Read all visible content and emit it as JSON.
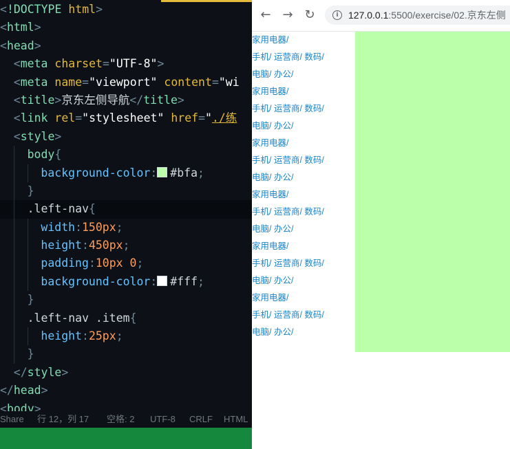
{
  "editor": {
    "lines": [
      {
        "indent": 0,
        "tokens": [
          [
            "punct",
            "<"
          ],
          [
            "tag",
            "!DOCTYPE"
          ],
          [
            "plain",
            " "
          ],
          [
            "attr",
            "html"
          ],
          [
            "punct",
            ">"
          ]
        ]
      },
      {
        "indent": 0,
        "tokens": [
          [
            "punct",
            "<"
          ],
          [
            "tag",
            "html"
          ],
          [
            "punct",
            ">"
          ]
        ]
      },
      {
        "indent": 0,
        "tokens": [
          [
            "punct",
            "<"
          ],
          [
            "tag",
            "head"
          ],
          [
            "punct",
            ">"
          ]
        ]
      },
      {
        "indent": 1,
        "tokens": [
          [
            "punct",
            "<"
          ],
          [
            "tag",
            "meta"
          ],
          [
            "plain",
            " "
          ],
          [
            "attr",
            "charset"
          ],
          [
            "punct",
            "="
          ],
          [
            "str",
            "\"UTF-8\""
          ],
          [
            "punct",
            ">"
          ]
        ]
      },
      {
        "indent": 1,
        "tokens": [
          [
            "punct",
            "<"
          ],
          [
            "tag",
            "meta"
          ],
          [
            "plain",
            " "
          ],
          [
            "attr",
            "name"
          ],
          [
            "punct",
            "="
          ],
          [
            "str",
            "\"viewport\""
          ],
          [
            "plain",
            " "
          ],
          [
            "attr",
            "content"
          ],
          [
            "punct",
            "="
          ],
          [
            "str",
            "\"wi"
          ]
        ]
      },
      {
        "indent": 1,
        "tokens": [
          [
            "punct",
            "<"
          ],
          [
            "tag",
            "title"
          ],
          [
            "punct",
            ">"
          ],
          [
            "text",
            "京东左侧导航"
          ],
          [
            "punct",
            "</"
          ],
          [
            "tag",
            "title"
          ],
          [
            "punct",
            ">"
          ]
        ]
      },
      {
        "indent": 1,
        "tokens": [
          [
            "punct",
            "<"
          ],
          [
            "tag",
            "link"
          ],
          [
            "plain",
            " "
          ],
          [
            "attr",
            "rel"
          ],
          [
            "punct",
            "="
          ],
          [
            "str",
            "\"stylesheet\""
          ],
          [
            "plain",
            " "
          ],
          [
            "attr",
            "href"
          ],
          [
            "punct",
            "="
          ],
          [
            "str",
            "\""
          ],
          [
            "link",
            "./练"
          ]
        ]
      },
      {
        "indent": 1,
        "tokens": [
          [
            "punct",
            "<"
          ],
          [
            "tag",
            "style"
          ],
          [
            "punct",
            ">"
          ]
        ]
      },
      {
        "indent": 2,
        "tokens": [
          [
            "tag",
            "body"
          ],
          [
            "punct",
            "{"
          ]
        ]
      },
      {
        "indent": 3,
        "tokens": [
          [
            "prop",
            "background-color"
          ],
          [
            "punct",
            ":"
          ],
          [
            "swatch",
            "#bbffaa"
          ],
          [
            "plain",
            "#bfa"
          ],
          [
            "punct",
            ";"
          ]
        ]
      },
      {
        "indent": 2,
        "tokens": [
          [
            "punct",
            "}"
          ]
        ]
      },
      {
        "indent": 2,
        "current": true,
        "tokens": [
          [
            "sel",
            ".left-nav"
          ],
          [
            "punct",
            "{"
          ]
        ]
      },
      {
        "indent": 3,
        "tokens": [
          [
            "prop",
            "width"
          ],
          [
            "punct",
            ":"
          ],
          [
            "val",
            "150px"
          ],
          [
            "punct",
            ";"
          ]
        ]
      },
      {
        "indent": 3,
        "tokens": [
          [
            "prop",
            "height"
          ],
          [
            "punct",
            ":"
          ],
          [
            "val",
            "450px"
          ],
          [
            "punct",
            ";"
          ]
        ]
      },
      {
        "indent": 3,
        "tokens": [
          [
            "prop",
            "padding"
          ],
          [
            "punct",
            ":"
          ],
          [
            "val",
            "10px 0"
          ],
          [
            "punct",
            ";"
          ]
        ]
      },
      {
        "indent": 3,
        "tokens": [
          [
            "prop",
            "background-color"
          ],
          [
            "punct",
            ":"
          ],
          [
            "swatch",
            "#ffffff"
          ],
          [
            "plain",
            "#fff"
          ],
          [
            "punct",
            ";"
          ]
        ]
      },
      {
        "indent": 2,
        "tokens": [
          [
            "punct",
            "}"
          ]
        ]
      },
      {
        "indent": 2,
        "tokens": [
          [
            "sel",
            ".left-nav .item"
          ],
          [
            "punct",
            "{"
          ]
        ]
      },
      {
        "indent": 3,
        "tokens": [
          [
            "prop",
            "height"
          ],
          [
            "punct",
            ":"
          ],
          [
            "val",
            "25px"
          ],
          [
            "punct",
            ";"
          ]
        ]
      },
      {
        "indent": 2,
        "tokens": [
          [
            "punct",
            "}"
          ]
        ]
      },
      {
        "indent": 1,
        "tokens": [
          [
            "punct",
            "</"
          ],
          [
            "tag",
            "style"
          ],
          [
            "punct",
            ">"
          ]
        ]
      },
      {
        "indent": 0,
        "tokens": [
          [
            "punct",
            "</"
          ],
          [
            "tag",
            "head"
          ],
          [
            "punct",
            ">"
          ]
        ]
      },
      {
        "indent": 0,
        "tokens": [
          [
            "punct",
            "<"
          ],
          [
            "tag",
            "body"
          ],
          [
            "punct",
            ">"
          ]
        ]
      }
    ],
    "status": {
      "share": "Share",
      "position": "行 12，列 17",
      "spaces": "空格: 2",
      "encoding": "UTF-8",
      "eol": "CRLF",
      "language": "HTML"
    }
  },
  "browser": {
    "url_host": "127.0.0.1",
    "url_path": ":5500/exercise/02.京东左侧",
    "nav_items": [
      "家用电器/",
      "手机/ 运营商/ 数码/",
      "电脑/ 办公/",
      "家用电器/",
      "手机/ 运营商/ 数码/",
      "电脑/ 办公/",
      "家用电器/",
      "手机/ 运营商/ 数码/",
      "电脑/ 办公/",
      "家用电器/",
      "手机/ 运营商/ 数码/",
      "电脑/ 办公/",
      "家用电器/",
      "手机/ 运营商/ 数码/",
      "电脑/ 办公/",
      "家用电器/",
      "手机/ 运营商/ 数码/",
      "电脑/ 办公/"
    ],
    "icons": {
      "back": "arrow-left",
      "forward": "arrow-right",
      "reload": "reload",
      "info": "info"
    }
  },
  "colors": {
    "page_background": "#bbffaa",
    "nav_background": "#ffffff",
    "nav_text": "#1a84c8",
    "editor_background": "#0d1117",
    "status_green": "#16883d"
  }
}
